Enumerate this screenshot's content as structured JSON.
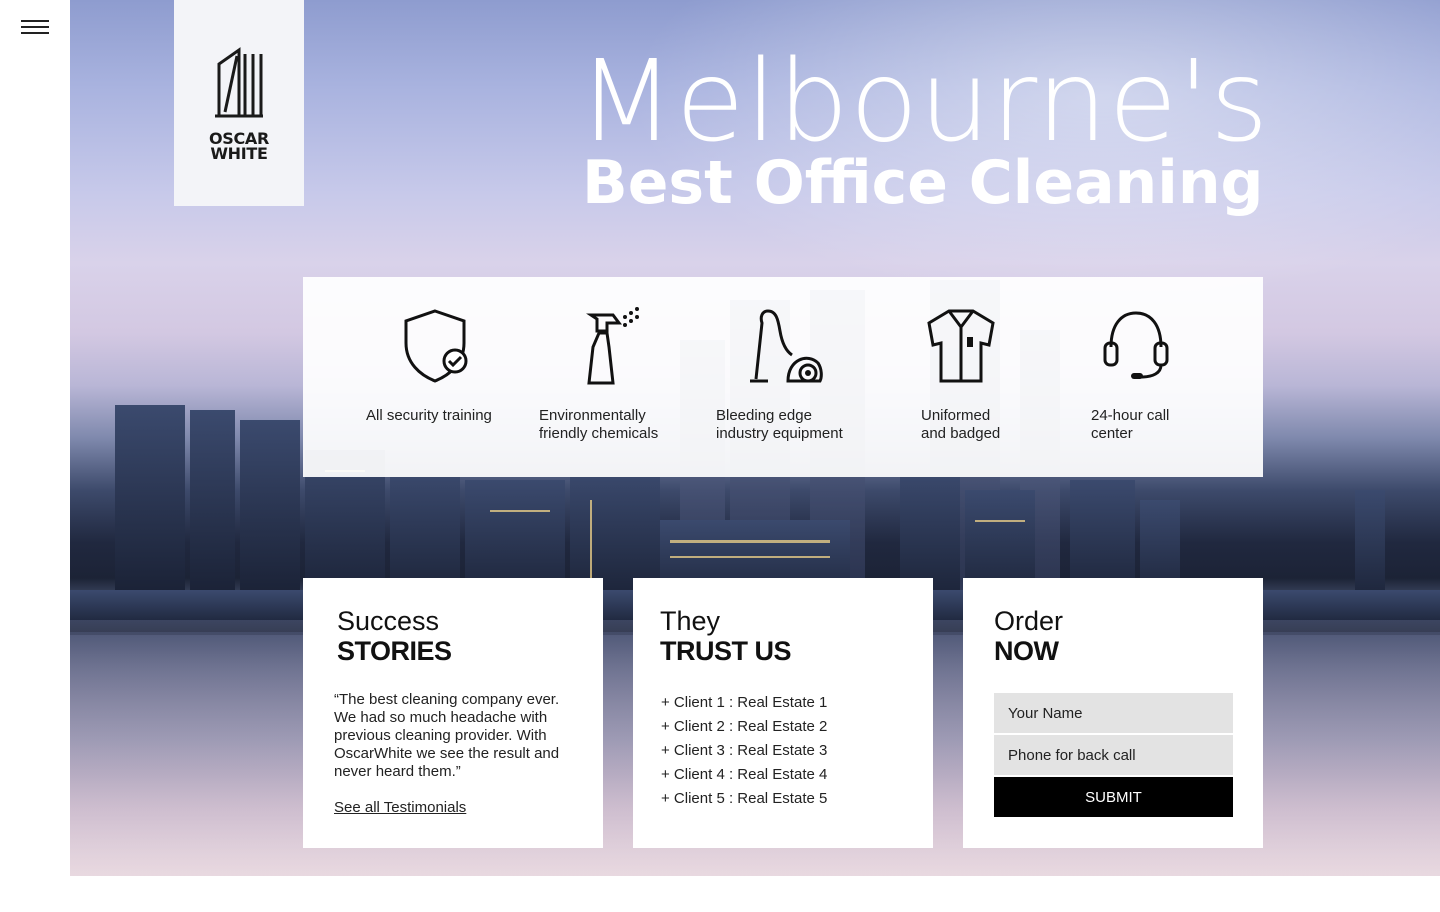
{
  "nav": {
    "menu_icon": "hamburger-menu-icon"
  },
  "logo": {
    "icon": "building-icon",
    "line1": "OSCAR",
    "line2": "WHITE"
  },
  "hero": {
    "headline_light": "Melbourne's",
    "headline_bold": "Best Office Cleaning",
    "background": "city-skyline-at-dusk-photo"
  },
  "features": [
    {
      "icon": "shield-check-icon",
      "line1": "All security training",
      "line2": ""
    },
    {
      "icon": "spray-bottle-icon",
      "line1": "Environmentally",
      "line2": "friendly chemicals"
    },
    {
      "icon": "vacuum-cleaner-icon",
      "line1": "Bleeding edge",
      "line2": "industry equipment"
    },
    {
      "icon": "uniform-shirt-icon",
      "line1": "Uniformed",
      "line2": "and badged"
    },
    {
      "icon": "headset-icon",
      "line1": "24-hour call",
      "line2": "center"
    }
  ],
  "cards": {
    "stories": {
      "title_light": "Success",
      "title_bold": "STORIES",
      "quote": "“The best cleaning company ever. We had so much headache with previous cleaning provider. With OscarWhite we see the result and never heard them.”",
      "link": "See all Testimonials"
    },
    "trust": {
      "title_light": "They",
      "title_bold": "TRUST US",
      "clients": [
        "+ Client 1 : Real Estate 1",
        "+ Client 2 : Real Estate 2",
        "+ Client 3 : Real Estate 3",
        "+ Client 4 : Real Estate 4",
        "+ Client 5 : Real Estate 5"
      ]
    },
    "order": {
      "title_light": "Order",
      "title_bold": "NOW",
      "name_placeholder": "Your Name",
      "phone_placeholder": "Phone for back call",
      "submit_label": "SUBMIT"
    }
  },
  "colors": {
    "card_bg": "#ffffff",
    "button_bg": "#000000",
    "input_bg": "#e3e3e3",
    "logo_bg": "#f3f4f8"
  }
}
